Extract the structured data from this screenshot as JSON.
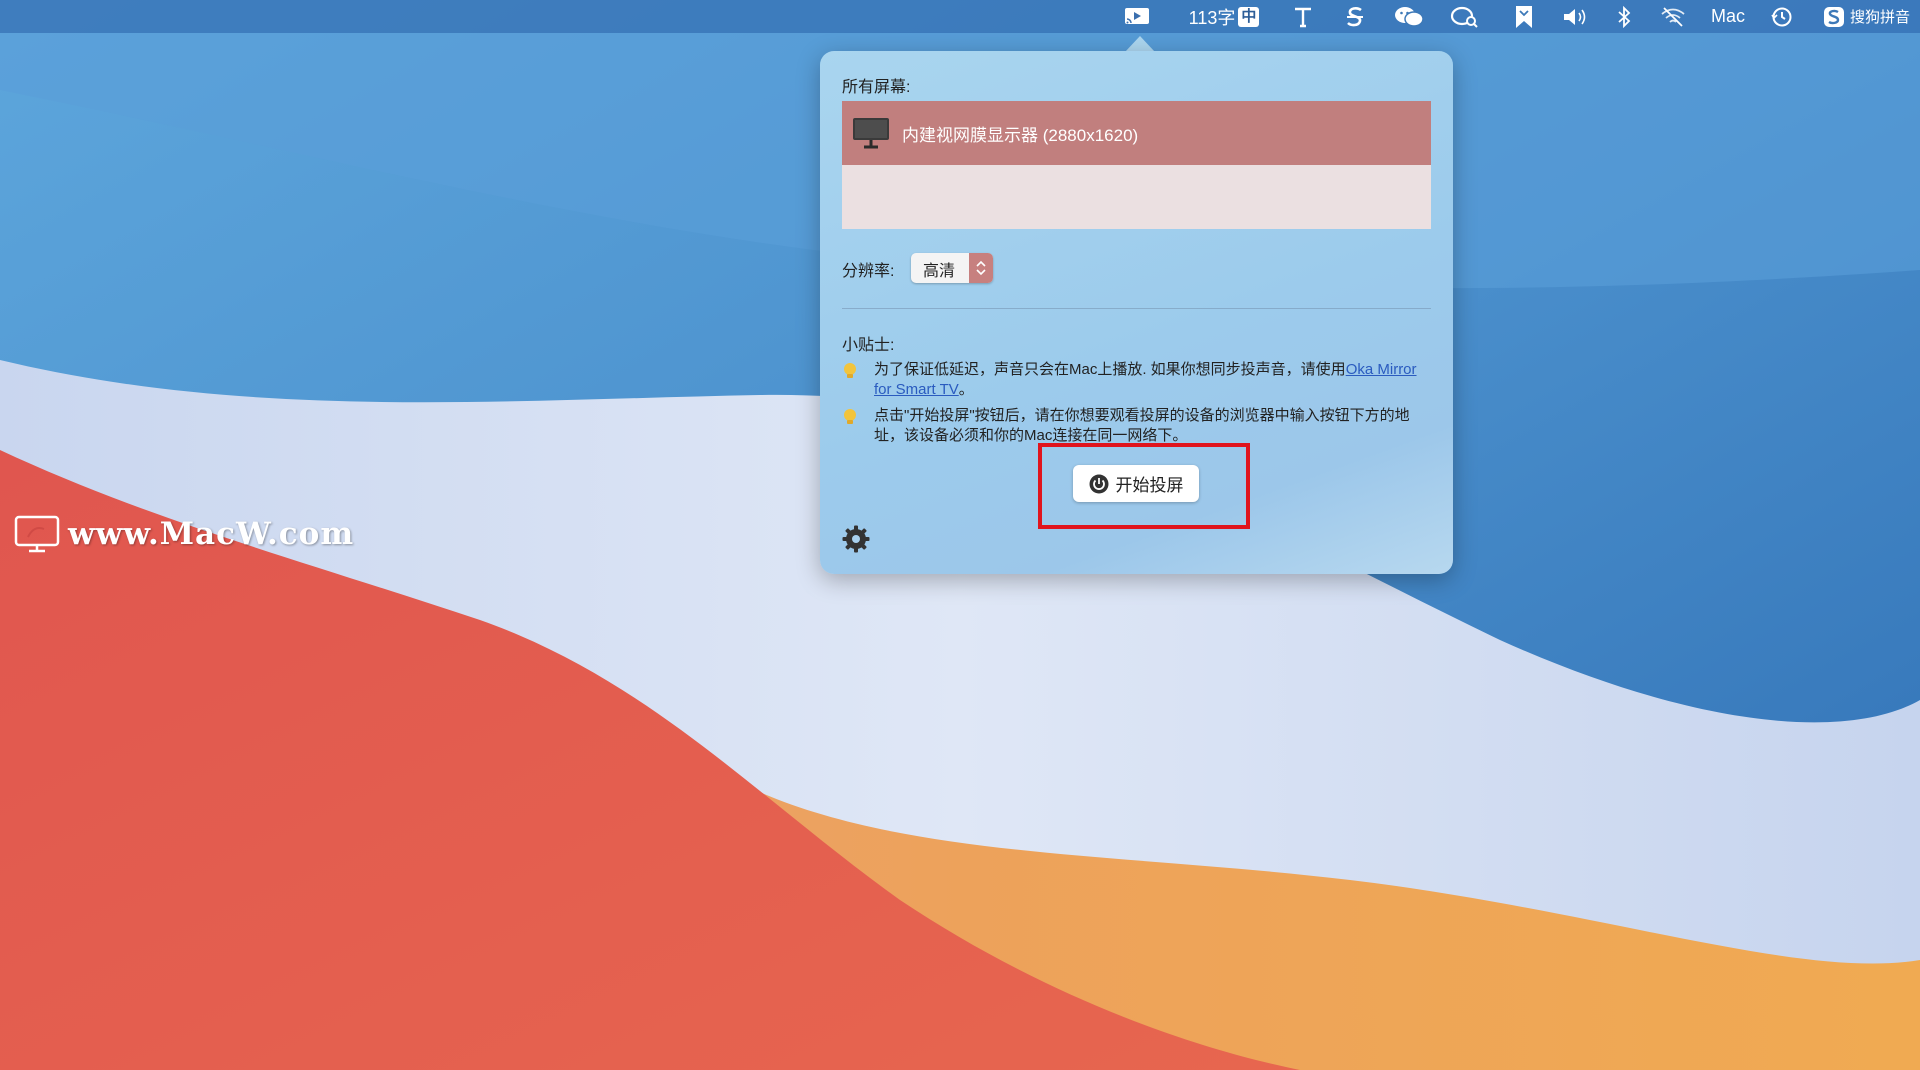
{
  "menubar": {
    "word_count": "113字",
    "input_mode": "中",
    "user_name": "Mac",
    "ime_name": "搜狗拼音",
    "icons": [
      "screen-mirror-icon",
      "text-tool-icon",
      "sogou-s-icon",
      "wechat-icon",
      "chat-search-icon",
      "bookmark-icon",
      "volume-icon",
      "bluetooth-icon",
      "wifi-off-icon",
      "time-machine-icon",
      "sogou-logo-icon"
    ]
  },
  "popover": {
    "screens_label": "所有屏幕:",
    "screens": [
      {
        "name": "内建视网膜显示器 (2880x1620)",
        "selected": true
      }
    ],
    "resolution_label": "分辨率:",
    "resolution_value": "高清",
    "tips_label": "小贴士:",
    "tip1_text": "为了保证低延迟，声音只会在Mac上播放. 如果你想同步投声音，请使用",
    "tip1_link": "Oka Mirror for Smart TV",
    "tip1_end": "。",
    "tip2_text": "点击\"开始投屏\"按钮后，请在你想要观看投屏的设备的浏览器中输入按钮下方的地址，该设备必须和你的Mac连接在同一网络下。",
    "start_button_label": "开始投屏",
    "highlight_color": "#e0141d"
  },
  "watermark": {
    "text": "www.MacW.com"
  },
  "colors": {
    "selected_row": "#c17f7e",
    "list_bg": "#ebe0e1",
    "link": "#2a5bbf"
  }
}
